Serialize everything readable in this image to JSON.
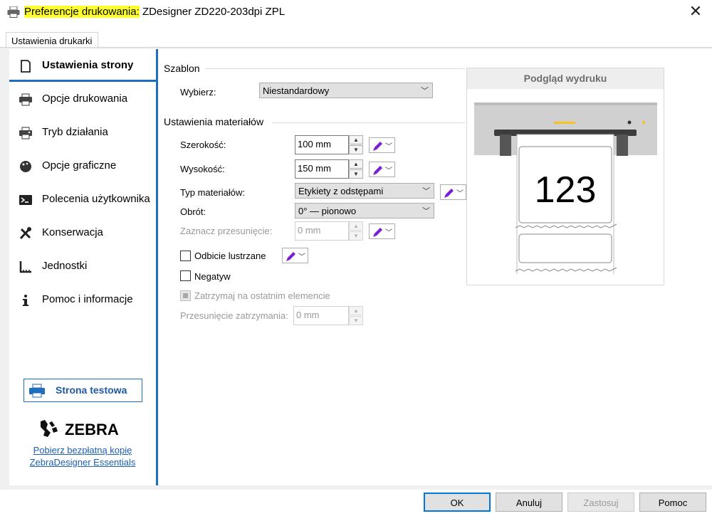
{
  "window": {
    "title_prefix": "Preferencje drukowania:",
    "title_rest": "ZDesigner ZD220-203dpi ZPL",
    "close_glyph": "✕"
  },
  "tab": {
    "label": "Ustawienia drukarki"
  },
  "sidebar": {
    "items": [
      {
        "label": "Ustawienia strony",
        "icon": "page-icon",
        "active": true
      },
      {
        "label": "Opcje drukowania",
        "icon": "printer-icon"
      },
      {
        "label": "Tryb działania",
        "icon": "printer-mode-icon"
      },
      {
        "label": "Opcje graficzne",
        "icon": "palette-icon"
      },
      {
        "label": "Polecenia użytkownika",
        "icon": "terminal-icon"
      },
      {
        "label": "Konserwacja",
        "icon": "tools-icon"
      },
      {
        "label": "Jednostki",
        "icon": "ruler-icon"
      },
      {
        "label": "Pomoc i informacje",
        "icon": "info-icon"
      }
    ],
    "test_page_label": "Strona testowa",
    "logo_text": "ZEBRA",
    "download_link_line1": "Pobierz bezpłatną kopię",
    "download_link_line2": "ZebraDesigner Essentials"
  },
  "template": {
    "group_title": "Szablon",
    "select_label": "Wybierz:",
    "select_value": "Niestandardowy"
  },
  "media": {
    "group_title": "Ustawienia materiałów",
    "width_label": "Szerokość:",
    "width_value": "100 mm",
    "height_label": "Wysokość:",
    "height_value": "150 mm",
    "media_type_label": "Typ materiałów:",
    "media_type_value": "Etykiety z odstępami",
    "rotation_label": "Obrót:",
    "rotation_value": "0° — pionowo",
    "offset_label": "Zaznacz przesunięcie:",
    "offset_value": "0 mm",
    "mirror_label": "Odbicie lustrzane",
    "negative_label": "Negatyw",
    "stop_last_label": "Zatrzymaj na ostatnim elemencie",
    "stop_offset_label": "Przesunięcie zatrzymania:",
    "stop_offset_value": "0 mm"
  },
  "preview": {
    "title": "Podgląd wydruku",
    "label_number": "123"
  },
  "buttons": {
    "ok": "OK",
    "cancel": "Anuluj",
    "apply": "Zastosuj",
    "help": "Pomoc"
  },
  "colors": {
    "accent": "#1e6ebd",
    "title_highlight": "#ffff2a",
    "pen_purple": "#7a1fd6"
  }
}
